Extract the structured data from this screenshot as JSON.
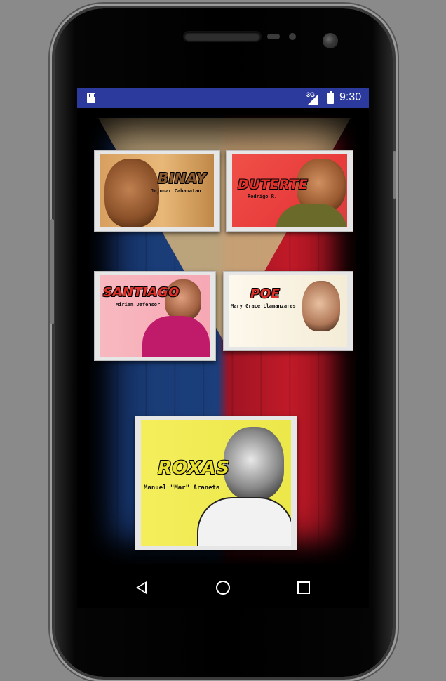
{
  "status_bar": {
    "network": "3G",
    "time": "9:30"
  },
  "icons": {
    "sd_card": "sd-card-icon",
    "signal": "signal-icon",
    "battery": "battery-icon",
    "back": "back-icon",
    "home": "home-icon",
    "recents": "recents-icon"
  },
  "colors": {
    "status_bar": "#2c3a9e",
    "flag_blue": "#1b3f7c",
    "flag_red": "#c01a28",
    "title_red": "#e0302a"
  },
  "candidates": [
    {
      "title": "BINAY",
      "subtitle": "Jejomar Cabauatan"
    },
    {
      "title": "DUTERTE",
      "subtitle": "Rodrigo R."
    },
    {
      "title": "SANTIAGO",
      "subtitle": "Miriam Defensor"
    },
    {
      "title": "POE",
      "subtitle": "Mary Grace Llamanzares"
    },
    {
      "title": "ROXAS",
      "subtitle": "Manuel \"Mar\" Araneta"
    }
  ]
}
